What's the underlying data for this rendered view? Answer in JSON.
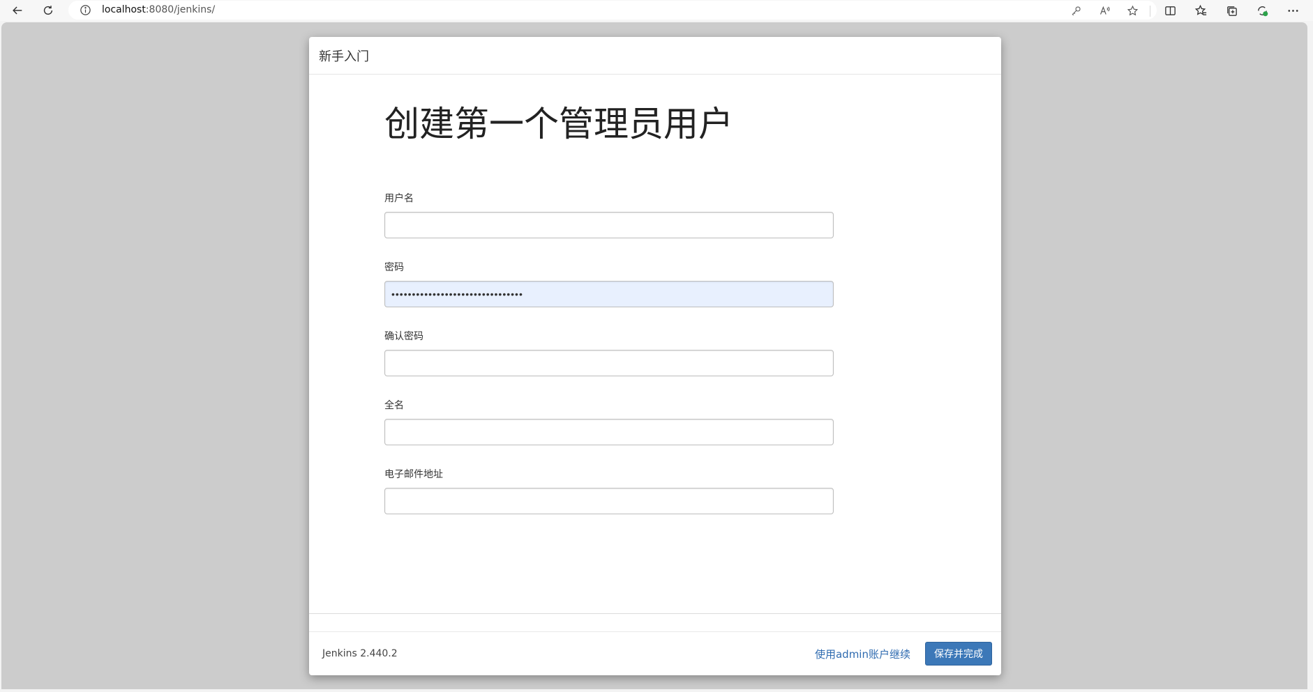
{
  "browser": {
    "url_host": "localhost",
    "url_rest": ":8080/jenkins/",
    "icons": {
      "back": "back-arrow-icon",
      "refresh": "refresh-icon",
      "info": "info-icon",
      "password_key": "key-icon",
      "read_aloud": "read-aloud-icon",
      "favorite": "star-icon",
      "split_screen": "split-screen-icon",
      "favorites": "favorites-icon",
      "collections": "collections-icon",
      "extensions": "extensions-icon",
      "more": "more-icon"
    }
  },
  "dialog": {
    "header_title": "新手入门",
    "heading": "创建第一个管理员用户",
    "fields": {
      "username": {
        "label": "用户名",
        "value": ""
      },
      "password": {
        "label": "密码",
        "value": "••••••••••••••••••••••••••••••••"
      },
      "confirm_password": {
        "label": "确认密码",
        "value": ""
      },
      "fullname": {
        "label": "全名",
        "value": ""
      },
      "email": {
        "label": "电子邮件地址",
        "value": ""
      }
    },
    "footer": {
      "version": "Jenkins 2.440.2",
      "continue_link": "使用admin账户继续",
      "save_button": "保存并完成"
    }
  },
  "colors": {
    "overlay_bg": "#cccccc",
    "link": "#2f6bb0",
    "primary_button": "#3c78b8",
    "autofill_bg": "#e8f0fe"
  }
}
